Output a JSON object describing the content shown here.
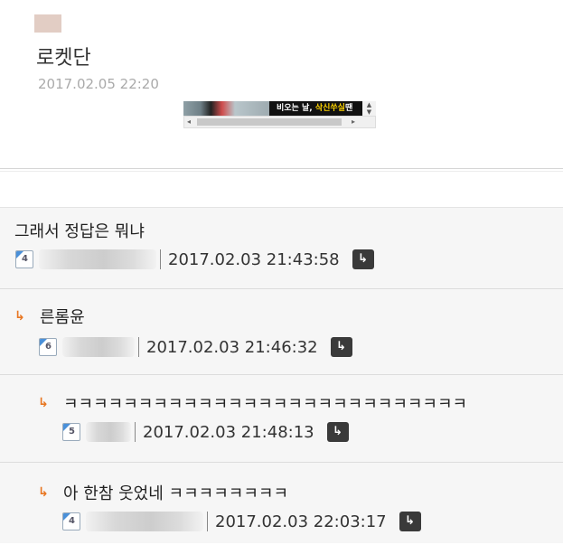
{
  "post": {
    "author": "로켓단",
    "date": "2017.02.05 22:20"
  },
  "ad": {
    "text_prefix": "비오는 날,",
    "text_highlight": "삭신쑤실",
    "text_suffix": "땐"
  },
  "comments": [
    {
      "text": "그래서 정답은 뭐냐",
      "level": "4",
      "date": "2017.02.03 21:43:58"
    },
    {
      "text": "른롬윤",
      "level": "6",
      "date": "2017.02.03 21:46:32"
    },
    {
      "text": "ㅋㅋㅋㅋㅋㅋㅋㅋㅋㅋㅋㅋㅋㅋㅋㅋㅋㅋㅋㅋㅋㅋㅋㅋㅋㅋㅋ",
      "level": "5",
      "date": "2017.02.03 21:48:13"
    },
    {
      "text": "아 한참 웃었네 ㅋㅋㅋㅋㅋㅋㅋㅋ",
      "level": "4",
      "date": "2017.02.03 22:03:17"
    }
  ],
  "colors": {
    "reply_arrow": "#e87722",
    "reply_button": "#3a3a3a",
    "level_accent": "#4a90d9"
  },
  "icons": {
    "reply_arrow": "reply-arrow-icon",
    "reply_button": "reply-icon",
    "level": "level-badge-icon"
  }
}
